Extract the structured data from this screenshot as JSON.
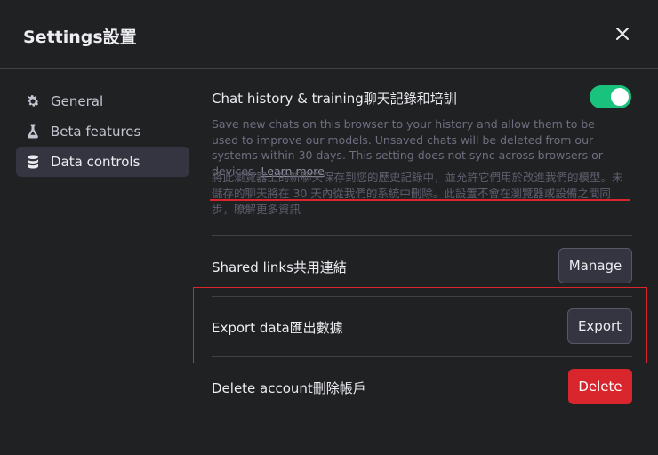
{
  "dialog": {
    "title": "Settings設置",
    "close_icon": "close-icon"
  },
  "sidebar": {
    "items": [
      {
        "label": "General",
        "icon": "gear-icon",
        "active": false
      },
      {
        "label": "Beta features",
        "icon": "flask-icon",
        "active": false
      },
      {
        "label": "Data controls",
        "icon": "database-icon",
        "active": true
      }
    ]
  },
  "chat_history": {
    "title": "Chat history & training聊天記錄和培訓",
    "enabled": true,
    "description": "Save new chats on this browser to your history and allow them to be used to improve our models. Unsaved chats will be deleted from our systems within 30 days. This setting does not sync across browsers or devices.",
    "learn_more": "Learn more",
    "description_zh": "將此瀏覽器上的新聊天保存到您的歷史記錄中，並允許它們用於改進我們的模型。未儲存的聊天將在 30 天內從我們的系統中刪除。此設置不會在瀏覽器或設備之間同步，瞭解更多資訊"
  },
  "shared_links": {
    "label": "Shared links共用連結",
    "button": "Manage"
  },
  "export_data": {
    "label": "Export data匯出數據",
    "button": "Export"
  },
  "delete_account": {
    "label": "Delete account刪除帳戶",
    "button": "Delete"
  },
  "colors": {
    "background": "#202123",
    "toggle_on": "#19c37d",
    "danger": "#d9262c",
    "annotation": "#d9262c"
  }
}
